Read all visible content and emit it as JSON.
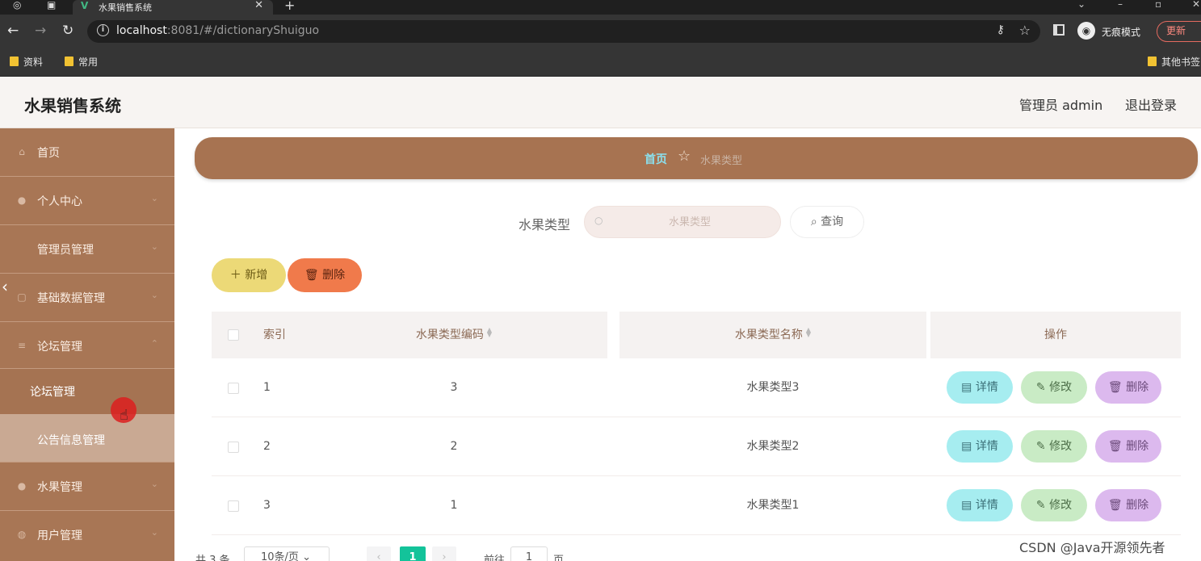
{
  "browser": {
    "tab_title": "水果销售系统",
    "url_host": "localhost",
    "url_rest": ":8081/#/dictionaryShuiguo",
    "incognito_label": "无痕模式",
    "update_label": "更新",
    "bookmarks": [
      "资料",
      "常用"
    ],
    "other_bookmarks": "其他书签"
  },
  "header": {
    "app_title": "水果销售系统",
    "admin_label": "管理员 admin",
    "logout": "退出登录"
  },
  "sidebar": {
    "items": [
      {
        "label": "首页",
        "icon": "home-icon"
      },
      {
        "label": "个人中心",
        "icon": "user-icon"
      },
      {
        "label": "管理员管理",
        "icon": ""
      },
      {
        "label": "基础数据管理",
        "icon": "grid-icon"
      },
      {
        "label": "论坛管理",
        "icon": "menu-icon"
      },
      {
        "label": "水果管理",
        "icon": "fruit-icon"
      },
      {
        "label": "用户管理",
        "icon": "users-icon"
      }
    ],
    "submenu": [
      "论坛管理",
      "公告信息管理"
    ]
  },
  "breadcrumb": {
    "home": "首页",
    "current": "水果类型"
  },
  "search": {
    "label": "水果类型",
    "placeholder": "水果类型",
    "button": "查询"
  },
  "toolbar": {
    "add": "新增",
    "delete": "删除"
  },
  "table": {
    "headers": {
      "index": "索引",
      "code": "水果类型编码",
      "name": "水果类型名称",
      "actions": "操作"
    },
    "rows": [
      {
        "index": "1",
        "code": "3",
        "name": "水果类型3"
      },
      {
        "index": "2",
        "code": "2",
        "name": "水果类型2"
      },
      {
        "index": "3",
        "code": "1",
        "name": "水果类型1"
      }
    ],
    "action_labels": {
      "detail": "详情",
      "edit": "修改",
      "delete": "删除"
    }
  },
  "pagination": {
    "total": "共 3 条",
    "page_size": "10条/页",
    "current_page": "1",
    "goto_label": "前往",
    "goto_value": "1",
    "page_unit": "页"
  },
  "watermark": "CSDN @Java开源领先者",
  "colors": {
    "sidebar": "#a87655",
    "breadcrumb": "#a77351",
    "add_button": "#ecd977",
    "delete_button": "#f07a4b",
    "detail_button": "#a6edf0",
    "edit_button": "#c9ebc5",
    "row_delete_button": "#dcb9ee",
    "pager_active": "#13c39a"
  }
}
